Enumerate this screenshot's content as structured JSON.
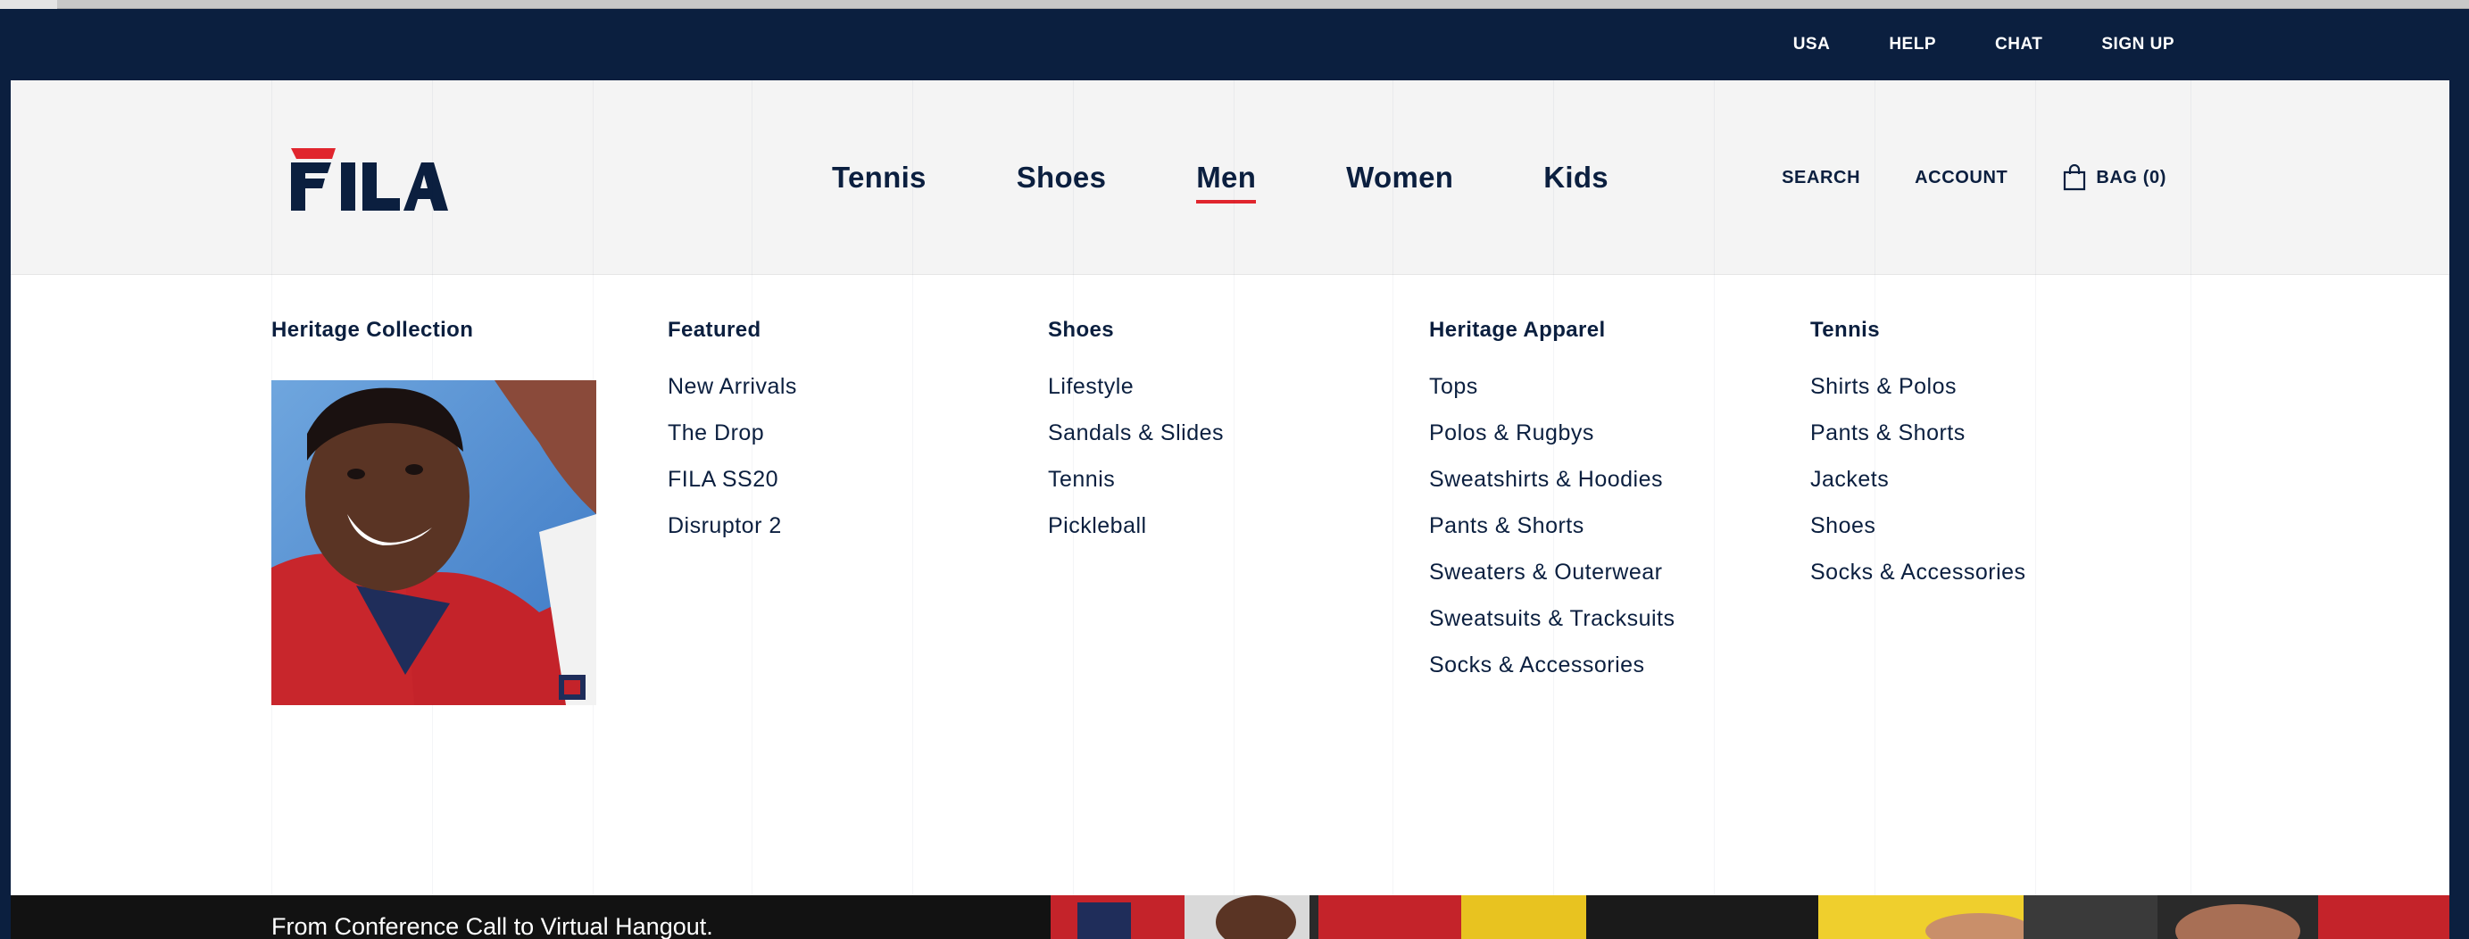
{
  "utility_nav": [
    "USA",
    "HELP",
    "CHAT",
    "SIGN UP"
  ],
  "main_nav": {
    "items": [
      "Tennis",
      "Shoes",
      "Men",
      "Women",
      "Kids"
    ],
    "active": "Men"
  },
  "right_nav": {
    "search": "SEARCH",
    "account": "ACCOUNT",
    "bag": "BAG (0)"
  },
  "icons": {
    "logo": "fila-logo",
    "bag": "shopping-bag-icon"
  },
  "colors": {
    "navy": "#0b1f3f",
    "accent_red": "#e0252d",
    "header_bg": "#f4f4f4"
  },
  "dropdown": {
    "heritage": {
      "heading": "Heritage Collection"
    },
    "featured": {
      "heading": "Featured",
      "links": [
        "New Arrivals",
        "The Drop",
        "FILA SS20",
        "Disruptor 2"
      ]
    },
    "shoes": {
      "heading": "Shoes",
      "links": [
        "Lifestyle",
        "Sandals & Slides",
        "Tennis",
        "Pickleball"
      ]
    },
    "heritage_apparel": {
      "heading": "Heritage Apparel",
      "links": [
        "Tops",
        "Polos & Rugbys",
        "Sweatshirts & Hoodies",
        "Pants & Shorts",
        "Sweaters & Outerwear",
        "Sweatsuits & Tracksuits",
        "Socks & Accessories"
      ]
    },
    "tennis": {
      "heading": "Tennis",
      "links": [
        "Shirts & Polos",
        "Pants & Shorts",
        "Jackets",
        "Shoes",
        "Socks & Accessories"
      ]
    }
  },
  "hero": {
    "text": "From Conference Call to Virtual Hangout."
  }
}
